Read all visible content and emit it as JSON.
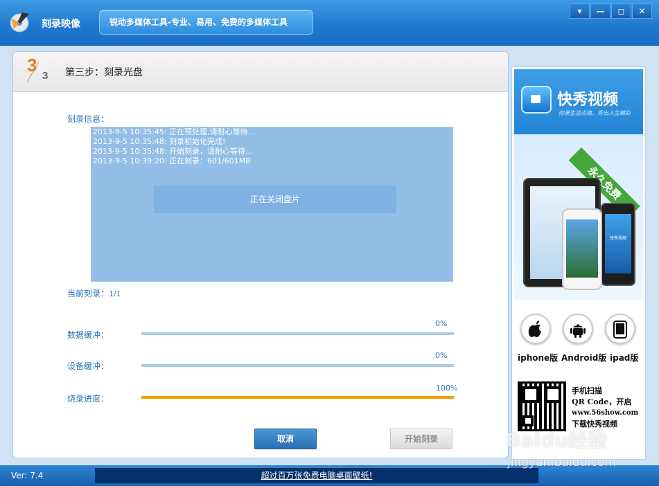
{
  "app": {
    "title": "刻录映像",
    "slogan": "锐动多媒体工具-专业、易用、免费的多媒体工具"
  },
  "window_buttons": [
    "▾",
    "—",
    "◻",
    "✕"
  ],
  "step": {
    "current": "3",
    "total": "3",
    "title": "第三步：刻录光盘"
  },
  "burn_info": {
    "label": "刻录信息：",
    "log": [
      "2013-9-5 10:35:45:  正在预处理,请耐心等待…",
      "2013-9-5 10:35:48:  刻录初始化完成!",
      "2013-9-5 10:35:48:  开始刻录，请耐心等待…",
      "2013-9-5 10:39:20:  正在刻录：601/601MB"
    ],
    "status": "正在关闭盘片"
  },
  "current_burn": {
    "label": "当前刻录：",
    "value": "1/1"
  },
  "progress": [
    {
      "label": "数据缓冲：",
      "percent": "0%",
      "fraction": 0.0,
      "color": "#a9cbe9"
    },
    {
      "label": "设备缓冲：",
      "percent": "0%",
      "fraction": 0.0,
      "color": "#a9cbe9"
    },
    {
      "label": "烧录进度：",
      "percent": "100%",
      "fraction": 1.0,
      "color": "#f0a000"
    }
  ],
  "buttons": {
    "cancel": "取消",
    "start": "开始刻录"
  },
  "ad": {
    "brand": "快秀视频",
    "tagline": "你录生活点滴，秀出人生精彩",
    "ribbon": "永久免费",
    "phone_label": "快秀视频",
    "platforms": [
      {
        "label": "iphone版",
        "icon": "apple-icon",
        "glyph": ""
      },
      {
        "label": "Android版",
        "icon": "android-icon",
        "glyph": "🤖"
      },
      {
        "label": "ipad版",
        "icon": "ipad-icon",
        "glyph": "▯"
      }
    ],
    "qr_text": [
      "手机扫描",
      "QR Code，开启",
      "www.56show.com",
      "下载快秀视频"
    ]
  },
  "status_bar": {
    "version": "Ver: 7.4",
    "link": "超过百万张免费电脑桌面壁纸!"
  },
  "watermark": {
    "main": "Baidu经验",
    "sub": "jingyan.baidu.com"
  }
}
